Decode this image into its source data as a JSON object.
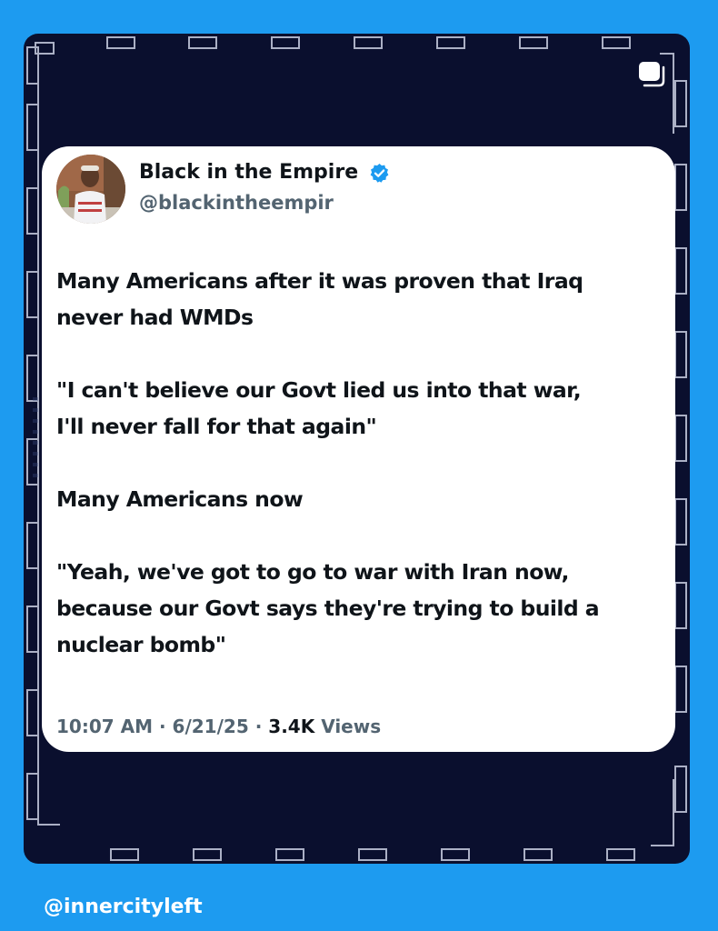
{
  "tweet": {
    "display_name": "Black in the Empire",
    "handle": "@blackintheempir",
    "paragraphs": [
      "Many Americans after it was proven that Iraq never had WMDs",
      "\"I can't believe our Govt lied us into that war, I'll never fall for that again\"",
      "Many Americans now",
      "\"Yeah, we've got to go to war with Iran now, because our Govt says they're trying to build a nuclear bomb\""
    ],
    "paragraph_lines": [
      [
        "Many Americans after it was proven that Iraq",
        "never had WMDs"
      ],
      [
        "\"I can't believe our Govt lied us into that war,",
        "I'll never fall for that again\""
      ],
      [
        "Many Americans now"
      ],
      [
        "\"Yeah, we've got to go to war with Iran now,",
        "because our Govt says they're trying to build a",
        "nuclear bomb\""
      ]
    ],
    "time": "10:07 AM",
    "date": "6/21/25",
    "separator": " · ",
    "views_count": "3.4K",
    "views_label": "Views"
  },
  "watermark": "@innercityleft",
  "icons": {
    "verified": "verified-badge-icon",
    "copy": "multiple-images-icon"
  },
  "colors": {
    "background": "#1d9bf0",
    "frame": "#0a0f2e",
    "verified": "#1d9bf0",
    "text": "#0f1419",
    "muted": "#536471"
  }
}
